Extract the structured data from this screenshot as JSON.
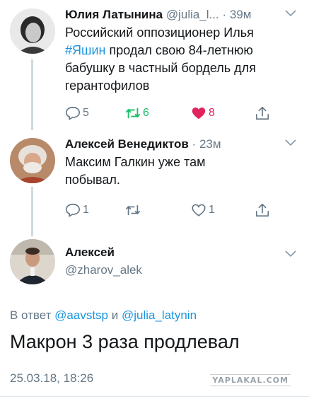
{
  "tweets": [
    {
      "name": "Юлия Латынина",
      "handle": "@julia_l...",
      "separator": "·",
      "time": "39м",
      "text_before": "Российский оппозиционер Илья ",
      "hashtag": "#Яшин",
      "text_after": " продал свою 84-летнюю бабушку в частный бордель для герантофилов",
      "replies": "5",
      "retweets": "6",
      "likes": "8"
    },
    {
      "name": "Алексей Венедиктов",
      "separator": "·",
      "time": "23м",
      "text": "Максим Галкин уже там побывал.",
      "replies": "1",
      "retweets": "",
      "likes": "1"
    }
  ],
  "main_tweet": {
    "name": "Алексей",
    "handle": "@zharov_alek",
    "reply_prefix": "В ответ ",
    "reply_user1": "@aavstsp",
    "reply_and": " и ",
    "reply_user2": "@julia_latynin",
    "text": "Макрон 3 раза продлевал",
    "timestamp": "25.03.18, 18:26"
  },
  "watermark": "YAPLAKAL.COM",
  "colors": {
    "accent": "#1b95e0",
    "retweet": "#17bf63",
    "like": "#e0245e",
    "muted": "#657786"
  },
  "icons": [
    "reply-icon",
    "retweet-icon",
    "heart-icon",
    "share-icon",
    "chevron-down-icon"
  ]
}
